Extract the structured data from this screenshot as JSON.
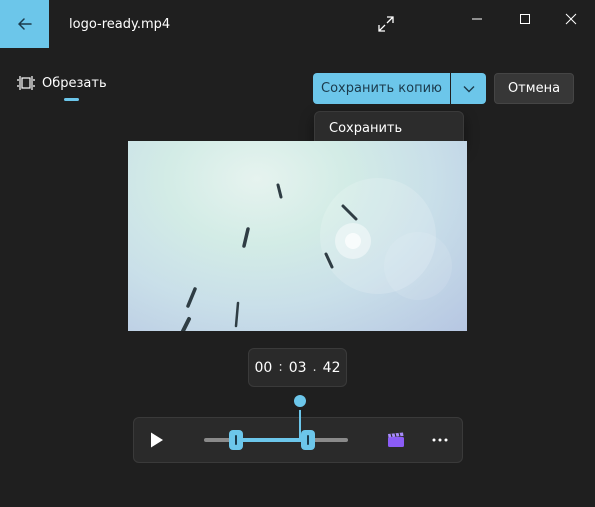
{
  "window": {
    "title": "logo-ready.mp4"
  },
  "icons": {
    "back": "arrow-left-icon",
    "expand": "expand-icon",
    "minimize": "minimize-icon",
    "maximize": "maximize-icon",
    "close": "close-icon",
    "trim": "trim-icon",
    "chevron": "chevron-down-icon",
    "play": "play-icon",
    "clip": "clapperboard-icon",
    "more": "more-icon"
  },
  "toolbar": {
    "trim_label": "Обрезать"
  },
  "actions": {
    "save_copy_label": "Сохранить копию",
    "cancel_label": "Отмена"
  },
  "menu": {
    "items": [
      {
        "label": "Сохранить"
      }
    ]
  },
  "timestamp": {
    "hours": "00",
    "minutes": "03",
    "frames": "42"
  },
  "timeline": {
    "trim_start": 0.22,
    "trim_end": 0.72,
    "playhead": 0.66
  },
  "colors": {
    "accent": "#6cc6ea",
    "background": "#1f1f1f",
    "surface": "#2a2a2a"
  }
}
